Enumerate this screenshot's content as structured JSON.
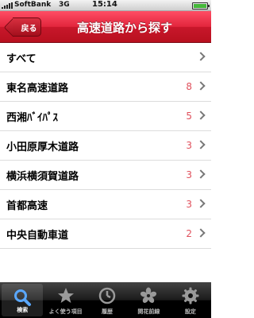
{
  "status_bar": {
    "carrier": "SoftBank",
    "network": "3G",
    "time": "15:14"
  },
  "nav": {
    "back_label": "戻る",
    "title": "高速道路から探す"
  },
  "list": [
    {
      "label": "すべて",
      "count": ""
    },
    {
      "label": "東名高速道路",
      "count": "8"
    },
    {
      "label": "西湘ﾊﾞｲﾊﾟｽ",
      "count": "5"
    },
    {
      "label": "小田原厚木道路",
      "count": "3"
    },
    {
      "label": "横浜横須賀道路",
      "count": "3"
    },
    {
      "label": "首都高速",
      "count": "3"
    },
    {
      "label": "中央自動車道",
      "count": "2"
    }
  ],
  "tabs": [
    {
      "label": "検索",
      "icon": "search-icon",
      "active": true
    },
    {
      "label": "よく使う項目",
      "icon": "star-icon",
      "active": false
    },
    {
      "label": "履歴",
      "icon": "clock-icon",
      "active": false
    },
    {
      "label": "開花前線",
      "icon": "blossom-icon",
      "active": false
    },
    {
      "label": "設定",
      "icon": "gear-icon",
      "active": false
    }
  ],
  "colors": {
    "nav_red": "#d4192d",
    "count_red": "#e0505c"
  }
}
